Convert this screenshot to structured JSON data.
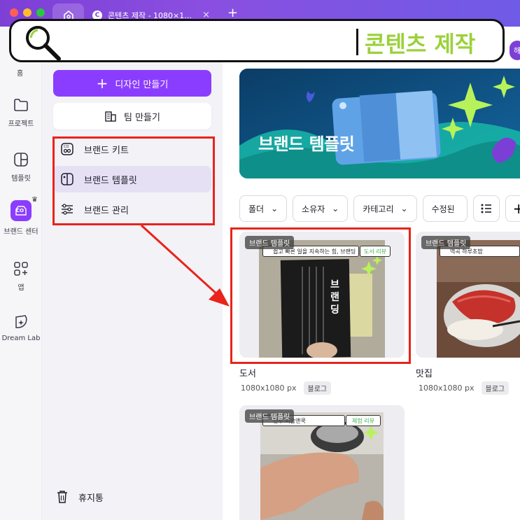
{
  "browser": {
    "tab_title": "콘텐츠 제작 - 1080×1...",
    "close_glyph": "×",
    "new_tab_glyph": "+"
  },
  "search": {
    "query": "콘텐츠 제작"
  },
  "avatar": {
    "initial": "해"
  },
  "rail": {
    "home_label": "홈",
    "items": [
      {
        "label": "프로젝트",
        "icon": "folder-icon"
      },
      {
        "label": "템플릿",
        "icon": "template-icon"
      },
      {
        "label": "브랜드 센터",
        "icon": "brand-icon",
        "badge": "CO"
      },
      {
        "label": "앱",
        "icon": "apps-icon"
      },
      {
        "label": "Dream Lab",
        "icon": "dream-lab-icon"
      }
    ]
  },
  "panel": {
    "create_label": "디자인 만들기",
    "team_label": "팀 만들기",
    "menu": [
      {
        "label": "브랜드 키트",
        "icon": "brand-kit-icon"
      },
      {
        "label": "브랜드 템플릿",
        "icon": "brand-template-icon",
        "active": true
      },
      {
        "label": "브랜드 관리",
        "icon": "sliders-icon"
      }
    ],
    "trash_label": "휴지통"
  },
  "main": {
    "banner_title": "브랜드 템플릿",
    "filters": [
      {
        "label": "폴더"
      },
      {
        "label": "소유자"
      },
      {
        "label": "카테고리"
      },
      {
        "label": "수정된"
      }
    ],
    "cards": [
      {
        "badge": "브랜드 템플릿",
        "bar_text": "쉽고 빠른 일을 지속하는 힘, 브랜딩",
        "tag_text": "도서 리뷰",
        "title": "도서",
        "size": "1080x1080 px",
        "meta_tag": "블로그"
      },
      {
        "badge": "브랜드 템플릿",
        "bar_text": "역곡 하루초밥",
        "title": "맛집",
        "size": "1080x1080 px",
        "meta_tag": "블로그"
      },
      {
        "badge": "브랜드 템플릿",
        "bar_text": "인주 미술앤쿡",
        "tag_text": "체험 리뷰"
      }
    ]
  },
  "colors": {
    "accent": "#8b3dff",
    "highlight": "#e8241c",
    "search_text": "#9bd13b"
  }
}
